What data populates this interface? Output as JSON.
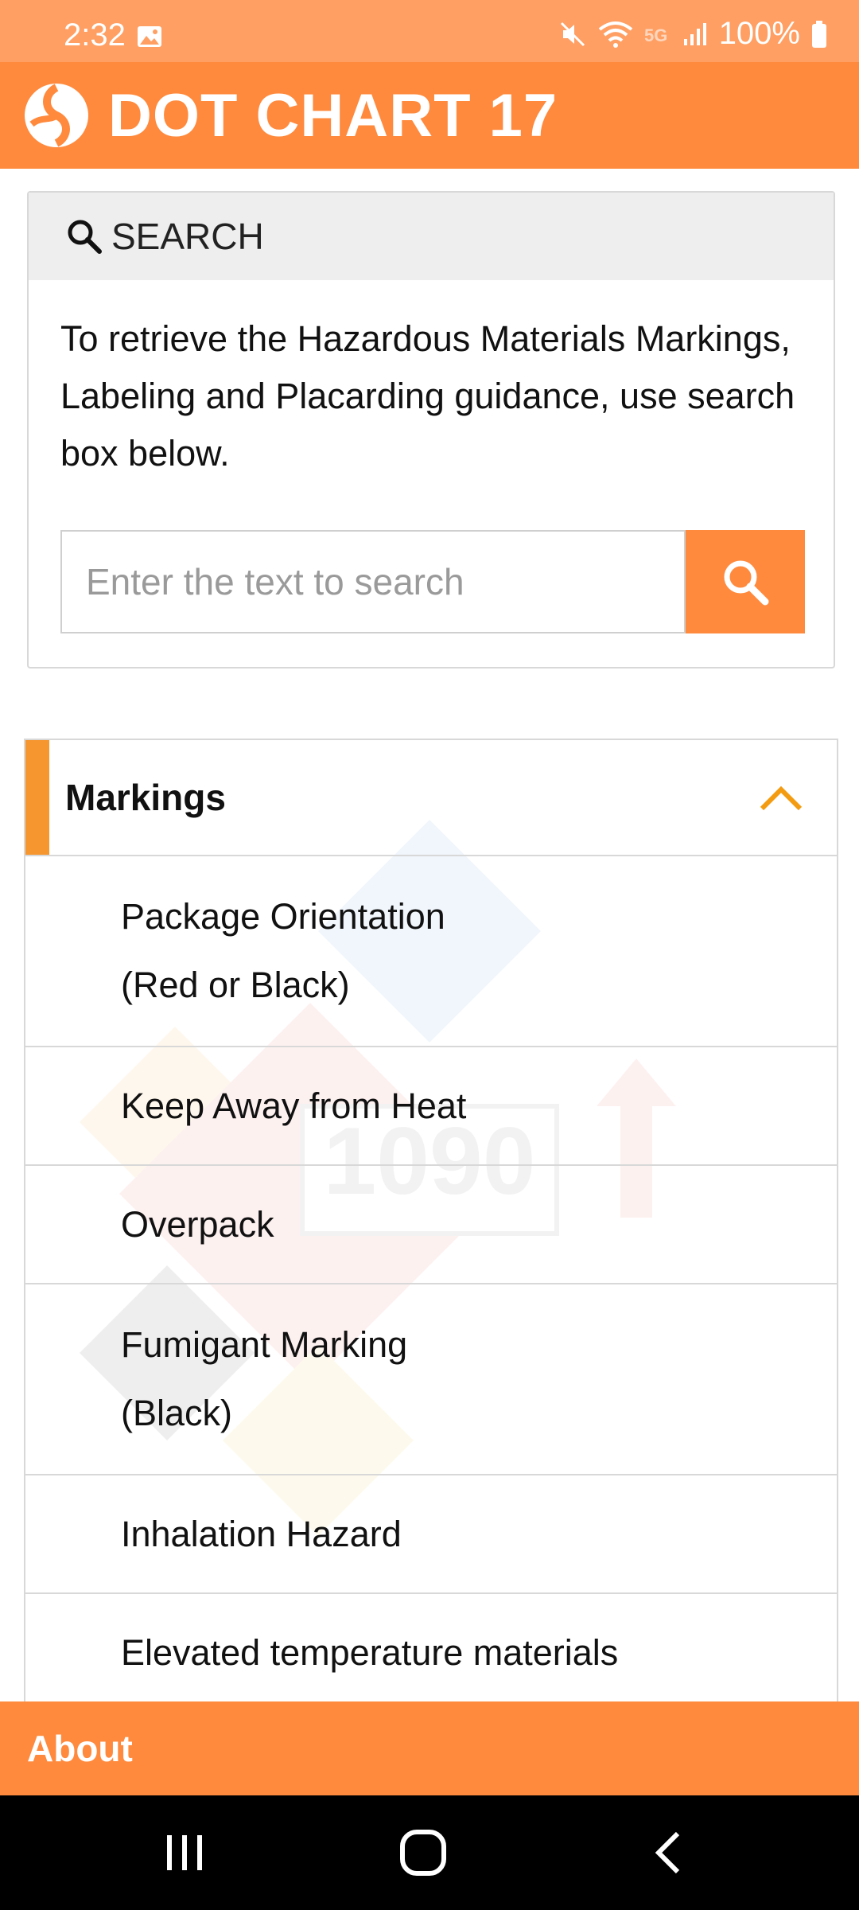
{
  "status_bar": {
    "time": "2:32",
    "battery": "100%",
    "icons": [
      "image-icon",
      "mute-icon",
      "wifi-icon",
      "5g-icon",
      "signal-icon",
      "battery-icon"
    ]
  },
  "header": {
    "title": "DOT CHART 17",
    "logo_icon": "dot-logo-icon"
  },
  "search": {
    "header_label": "SEARCH",
    "description": "To retrieve the Hazardous Materials Markings, Labeling and Placarding guidance, use search box below.",
    "input_value": "",
    "placeholder": "Enter the text to search",
    "button_icon": "search-icon"
  },
  "accordion": {
    "title": "Markings",
    "expanded": true,
    "toggle_icon": "chevron-up-icon",
    "items": [
      {
        "label_line1": "Package Orientation",
        "label_line2": "(Red or Black)"
      },
      {
        "label_line1": "Keep Away from Heat"
      },
      {
        "label_line1": "Overpack"
      },
      {
        "label_line1": "Fumigant Marking",
        "label_line2": "(Black)"
      },
      {
        "label_line1": "Inhalation Hazard"
      },
      {
        "label_line1": "Elevated temperature materials"
      }
    ]
  },
  "footer": {
    "about_label": "About"
  },
  "nav_bar": {
    "icons": [
      "recents-icon",
      "home-icon",
      "back-icon"
    ]
  },
  "colors": {
    "status_bar": "#ff9f63",
    "primary": "#ff8a3d",
    "accent": "#f6962f",
    "nav_bar": "#000000"
  }
}
